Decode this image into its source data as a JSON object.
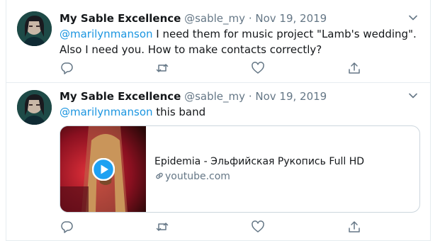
{
  "tweets": [
    {
      "author_name": "My Sable Excellence",
      "handle": "@sable_my",
      "separator": "·",
      "date": "Nov 19, 2019",
      "mention": "@marilynmanson",
      "text": "  I need them for music project \"Lamb's wedding\". Also I need you. How to make contacts correctly?"
    },
    {
      "author_name": "My Sable Excellence",
      "handle": "@sable_my",
      "separator": "·",
      "date": "Nov 19, 2019",
      "mention": "@marilynmanson",
      "text": " this band",
      "card": {
        "title": "Epidemia - Эльфийская Рукопись Full HD",
        "domain": "youtube.com"
      }
    }
  ],
  "icons": {
    "menu": "chevron-down-icon",
    "reply": "reply-icon",
    "retweet": "retweet-icon",
    "like": "heart-icon",
    "share": "share-icon",
    "link": "link-icon",
    "play": "play-icon"
  },
  "colors": {
    "accent": "#1b95e0",
    "secondary_text": "#657786",
    "border": "#e6ecf0"
  }
}
